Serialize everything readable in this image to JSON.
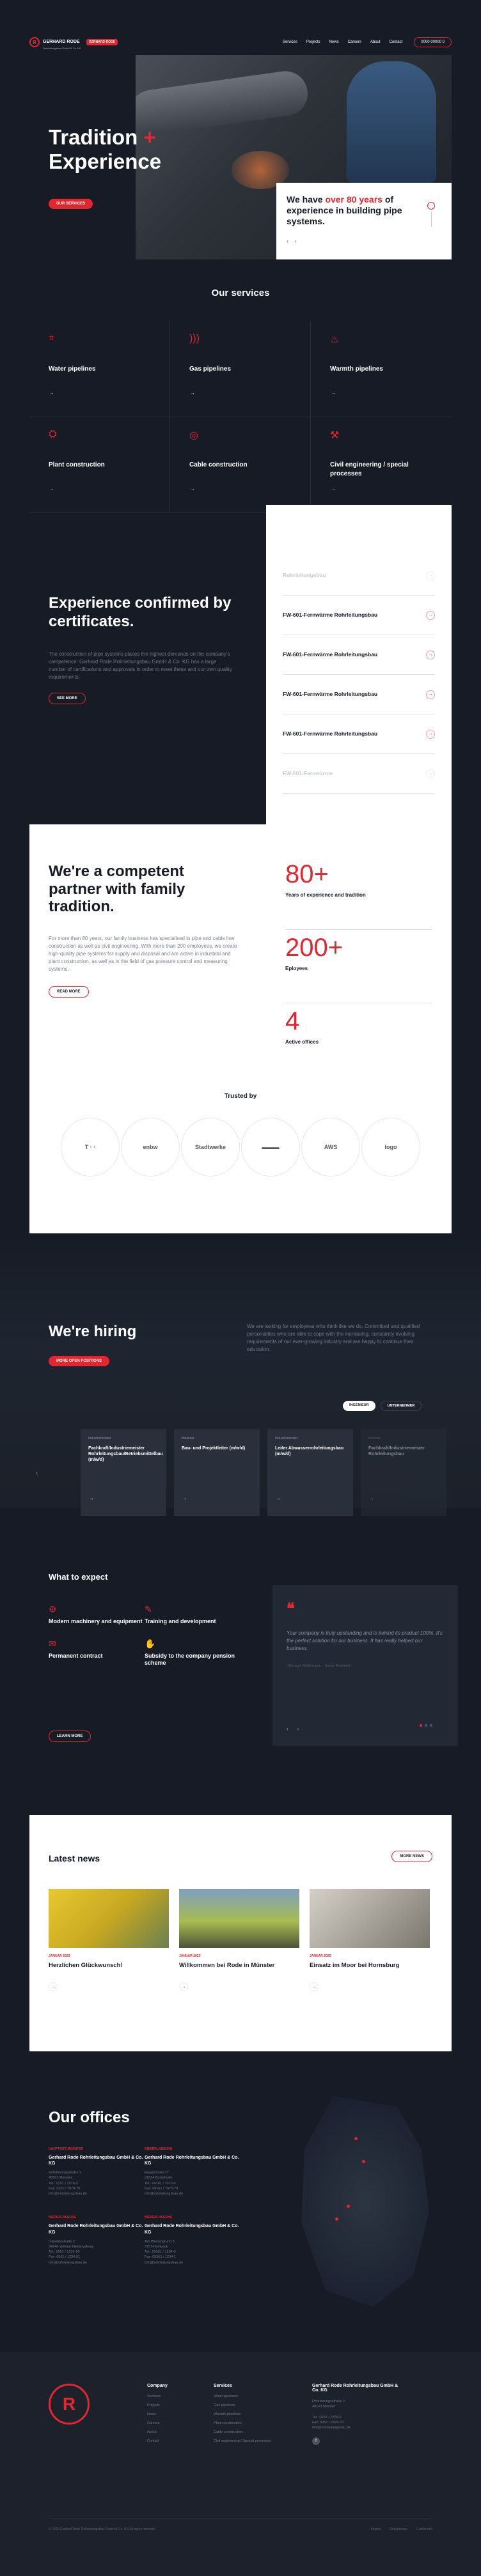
{
  "header": {
    "logo_name": "GERHARD RODE",
    "logo_sub": "Rohrleitungsbau GmbH & Co. KG",
    "badge": "GERHARD RODE",
    "nav": [
      "Services",
      "Projects",
      "News",
      "Careers",
      "About",
      "Contact"
    ],
    "contact_pill": "0000 00000 0"
  },
  "hero": {
    "title_line1": "Tradition",
    "title_plus": "+",
    "title_line2": "Experience",
    "button": "OUR SERVICES",
    "card_pre": "We have ",
    "card_highlight": "over 80 years",
    "card_post": " of experience in building pipe systems.",
    "prev": "‹",
    "next": "›"
  },
  "services": {
    "title": "Our services",
    "items": [
      {
        "name": "Water pipelines",
        "icon": "water-pipe-icon"
      },
      {
        "name": "Gas pipelines",
        "icon": "gas-icon"
      },
      {
        "name": "Warmth pipelines",
        "icon": "flame-icon"
      },
      {
        "name": "Plant construction",
        "icon": "plant-icon"
      },
      {
        "name": "Cable construction",
        "icon": "cable-icon"
      },
      {
        "name": "Civil engineering / special processes",
        "icon": "engineering-icon"
      }
    ]
  },
  "certificates": {
    "title": "Experience confirmed by certificates.",
    "text": "The construction of pipe systems places the highest demands on the company's competence. Gerhard Rode Rohrleitungsbau GmbH & Co. KG has a large number of certifications and approvals in order to meet these and our own quality requirements.",
    "button": "SEE MORE",
    "items": [
      {
        "label": "Rohrleitungsbau",
        "faded": true
      },
      {
        "label": "FW-601-Fernwärme Rohrleitungsbau",
        "faded": false
      },
      {
        "label": "FW-601-Fernwärme Rohrleitungsbau",
        "faded": false
      },
      {
        "label": "FW-601-Fernwärme Rohrleitungsbau",
        "faded": false
      },
      {
        "label": "FW-601-Fernwärme Rohrleitungsbau",
        "faded": false
      },
      {
        "label": "FW-601-Fernwärme",
        "faded": true
      }
    ]
  },
  "about": {
    "title": "We're a competent partner with family tradition.",
    "text": "For more than 80 years, our family business has specialised in pipe and cable line construction as well as civil engineering. With more than 200 employees, we create high-quality pipe systems for supply and disposal and are active in industrial and plant construction, as well as in the field of gas pressure control and measuring systems.",
    "button": "READ MORE",
    "stats": [
      {
        "value": "80+",
        "label": "Years of experience and tradition"
      },
      {
        "value": "200+",
        "label": "Eployees"
      },
      {
        "value": "4",
        "label": "Active offices"
      }
    ],
    "trusted_title": "Trusted by",
    "partners": [
      "T · ·",
      "enbw",
      "Stadtwerke",
      "▬▬▬",
      "AWS",
      "logo"
    ]
  },
  "hiring": {
    "title": "We're hiring",
    "button": "MORE OPEN POSITIONS",
    "text": "We are looking for employees who think like we do. Committed and qualified personalities who are able to cope with the increasing, constantly evolving requirements of our ever-growing industry and are happy to continue their education.",
    "tabs": [
      "INGENIEUR",
      "UNTERNEHMER"
    ],
    "jobs": [
      {
        "category": "Industriemeister",
        "title": "Fachkraft/Industriemeister Rohrleitungsbau/Betriebsmittelbau (m/w/d)",
        "faded": false
      },
      {
        "category": "Bauleiter",
        "title": "Bau- und Projektleiter (m/w/d)",
        "faded": false
      },
      {
        "category": "Industriemeister",
        "title": "Leiter Abwasserrohrleitungsbau (m/w/d)",
        "faded": false
      },
      {
        "category": "Bauleiter",
        "title": "Fachkraft/Industriemeister Rohrleitungsbau",
        "faded": true
      }
    ],
    "prev": "‹",
    "next": "›"
  },
  "expect": {
    "title": "What to expect",
    "benefits": [
      {
        "label": "Modern machinery and equipment",
        "icon": "machinery-icon"
      },
      {
        "label": "Training and development",
        "icon": "training-icon"
      },
      {
        "label": "Permanent contract",
        "icon": "contract-icon"
      },
      {
        "label": "Subsidy to the company pension scheme",
        "icon": "pension-icon"
      }
    ],
    "button": "LEARN MORE",
    "quote_mark": "❝",
    "quote": "Your company is truly upstanding and is behind its product 100%. It's the perfect solution for our business. It has really helped our business.",
    "quote_author": "Christoph Müllermann – Senior Engineer",
    "prev": "‹",
    "next": "›"
  },
  "news": {
    "title": "Latest news",
    "all_button": "MORE NEWS",
    "items": [
      {
        "date": "JANUAR 2022",
        "title": "Herzlichen Glückwunsch!",
        "img": "img1"
      },
      {
        "date": "JANUAR 2022",
        "title": "Willkommen bei Rode in Münster",
        "img": "img2"
      },
      {
        "date": "JANUAR 2022",
        "title": "Einsatz im Moor bei Hornsburg",
        "img": "img3"
      }
    ]
  },
  "offices": {
    "title": "Our offices",
    "items": [
      {
        "label": "HAUPTSITZ MÜNSTER",
        "name": "Gerhard Rode Rohrleitungsbau GmbH & Co. KG",
        "address": "Rohrleitungsstraße 2\n48163 Münster\nTel.: 0251 / 7878-0\nFax: 0251 / 7878-70\ninfo@rohrleitungsbau.de"
      },
      {
        "label": "NIEDERLASSUNG",
        "name": "Gerhard Rode Rohrleitungsbau GmbH & Co. KG",
        "address": "Hauptstraße 27\n21614 Buxtehude\nTel.: 04161 / 7070-0\nFax: 04161 / 7070-70\ninfo@rohrleitungsbau.de"
      },
      {
        "label": "NIEDERLASSUNG",
        "name": "Gerhard Rode Rohrleitungsbau GmbH & Co. KG",
        "address": "Industriestraße 2\n34246 Vellmar-Niedervellmar\nTel.: 0561 / 1234-50\nFax: 0561 / 1234-51\ninfo@rohrleitungsbau.de"
      },
      {
        "label": "NIEDERLASSUNG",
        "name": "Gerhard Rode Rohrleitungsbau GmbH & Co. KG",
        "address": "Am Wiesengrund 3\n37574 Einbeck\nTel.: 05561 / 1234-0\nFax: 05561 / 1234-1\ninfo@rohrleitungsbau.de"
      }
    ]
  },
  "footer": {
    "logo_letter": "R",
    "company_heading": "Company",
    "company_links": [
      "Services",
      "Projects",
      "News",
      "Careers",
      "About",
      "Contact"
    ],
    "services_heading": "Services",
    "services_links": [
      "Water pipelines",
      "Gas pipelines",
      "Warmth pipelines",
      "Plant construction",
      "Cable construction",
      "Civil engineering / Special processes"
    ],
    "address_name": "Gerhard Rode Rohrleitungsbau GmbH & Co. KG",
    "address": "Rohrleitungsstraße 2\n48163 Münster\n\nTel.: 0251 / 7878-0\nFax: 0251 / 7878-70\ninfo@rohrleitungsbau.de",
    "social_icon": "f",
    "copyright": "© 2022 Gerhard Rode Rohrleitungsbau GmbH & Co. KG All rights reserved",
    "legal_links": [
      "Imprint",
      "Data privacy",
      "Cookie info"
    ]
  },
  "colors": {
    "accent": "#e4262f",
    "background": "#161b25",
    "panel": "#2a303b"
  }
}
